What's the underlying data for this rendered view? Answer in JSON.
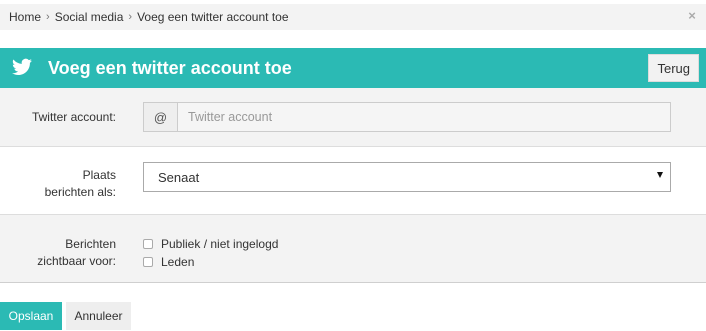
{
  "breadcrumb": {
    "items": [
      "Home",
      "Social media",
      "Voeg een twitter account toe"
    ],
    "separator": "›",
    "close_icon": "close-icon"
  },
  "header": {
    "icon": "twitter-icon",
    "title": "Voeg een twitter account toe",
    "back_label": "Terug",
    "color": "#2bbab4"
  },
  "form": {
    "twitter_account": {
      "label": "Twitter account:",
      "addon": "@",
      "placeholder": "Twitter account",
      "value": ""
    },
    "post_as": {
      "label_line1": "Plaats",
      "label_line2": "berichten als:",
      "selected": "Senaat"
    },
    "visibility": {
      "label_line1": "Berichten",
      "label_line2": "zichtbaar voor:",
      "options": [
        {
          "label": "Publiek / niet ingelogd",
          "checked": false
        },
        {
          "label": "Leden",
          "checked": false
        }
      ]
    }
  },
  "actions": {
    "save_label": "Opslaan",
    "cancel_label": "Annuleer"
  }
}
